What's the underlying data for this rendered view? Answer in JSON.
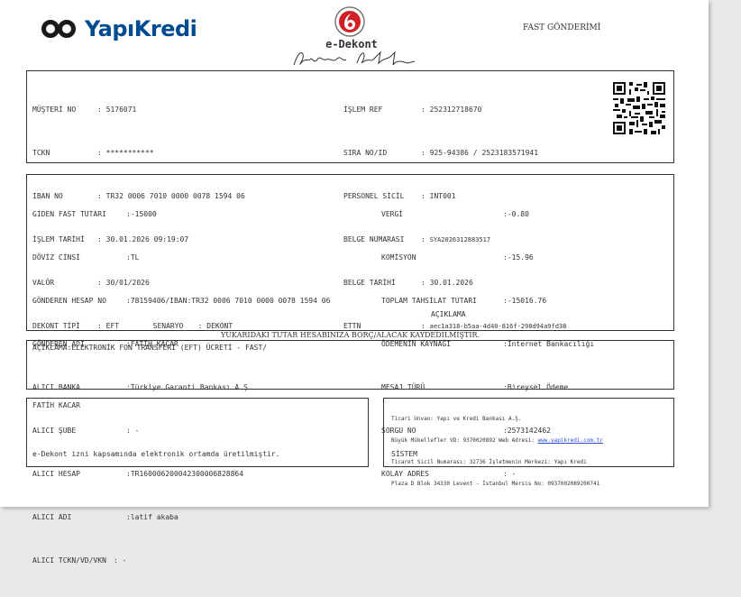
{
  "header": {
    "brand": "YapıKredi",
    "doc_title": "e-Dekont",
    "doc_type": "FAST GÖNDERİMİ"
  },
  "customer": {
    "left": [
      {
        "label": "MÜŞTERİ NO",
        "value": "5176071"
      },
      {
        "label": "TCKN",
        "value": "***********"
      },
      {
        "label": "IBAN NO",
        "value": "TR32 0006 7010 0000 0078 1594 06"
      },
      {
        "label": "İŞLEM TARİHİ",
        "value": "30.01.2026 09:19:07"
      },
      {
        "label": "VALÖR",
        "value": "30/01/2026"
      },
      {
        "label": "DEKONT TİPİ",
        "value": "EFT"
      }
    ],
    "senaryo_label": "SENARYO",
    "senaryo_value": "DEKONT",
    "right": [
      {
        "label": "İŞLEM REF",
        "value": "252312718670"
      },
      {
        "label": "SIRA NO/ID",
        "value": "925-94386 / 2523183571941"
      },
      {
        "label": "PERSONEL SİCİL",
        "value": "INT001"
      },
      {
        "label": "BELGE NUMARASI",
        "value": "SYA2026312883517"
      },
      {
        "label": "BELGE TARİHİ",
        "value": "30.01.2026"
      },
      {
        "label": "ETTN",
        "value": "aec1a318-b5aa-4d40-816f-298d94a9fd38"
      }
    ]
  },
  "transaction": {
    "left": [
      {
        "label": "GİDEN FAST TUTARI",
        "value": "-15000"
      },
      {
        "label": "DÖVİZ CİNSİ",
        "value": "TL"
      },
      {
        "label": "GÖNDEREN HESAP NO",
        "value": "78159406/IBAN:TR32 0006 7010 0000 0078 1594 06"
      },
      {
        "label": "GÖNDEREN ADI",
        "value": "FATİH KACAR"
      },
      {
        "label": "ALICI BANKA",
        "value": "Türkiye Garanti Bankası A.Ş."
      },
      {
        "label": "ALICI ŞUBE",
        "value": "-"
      },
      {
        "label": "ALICI HESAP",
        "value": "TR160006200042300006828864"
      },
      {
        "label": "ALICI ADI",
        "value": "latif akaba"
      },
      {
        "label": "ALICI TCKN/VD/VKN",
        "value": "-"
      }
    ],
    "right": [
      {
        "label": "VERGİ",
        "value": "-0.80"
      },
      {
        "label": "KOMİSYON",
        "value": "-15.96"
      },
      {
        "label": "TOPLAM TAHSİLAT TUTARI",
        "value": "-15016.76"
      },
      {
        "label": "ÖDEMENİN KAYNAĞI",
        "value": "İnternet Bankacılığı"
      },
      {
        "label": "MESAJ TÜRÜ",
        "value": "Bireysel Ödeme"
      },
      {
        "label": "SORGU NO",
        "value": "2573142462"
      },
      {
        "label": "KOLAY ADRES",
        "value": "-"
      }
    ],
    "aciklama_header": "AÇIKLAMA"
  },
  "notice": "YUKARIDAKİ TUTAR HESABINIZA BORÇ/ALACAK KAYDEDİLMİŞTİR.",
  "description": "AÇIKLAMA:ELEKTRONİK FON TRANSFERİ (EFT) ÜCRETİ - FAST/",
  "footer": {
    "name": "FATİH KACAR",
    "electronic_note": "e-Dekont izni kapsamında elektronik ortamda üretilmiştir.",
    "bank_line1": "Ticari Unvan: Yapı ve Kredi Bankası A.Ş.",
    "bank_line2_prefix": "Büyük Mükellefler VD: 9370020892 Web Adresi: ",
    "bank_web": "www.yapikredi.com.tr",
    "bank_line3": "Ticaret Sicil Numarası: 32736 İşletmenin Merkezi: Yapı Kredi",
    "bank_line4": "Plaza D Blok 34330 Levent - İstanbul Mersis No: 0937002089200741",
    "system": "SİSTEM"
  },
  "colors": {
    "brand": "#004a8f",
    "seal": "#d21f26",
    "link": "#2a4fd0"
  }
}
